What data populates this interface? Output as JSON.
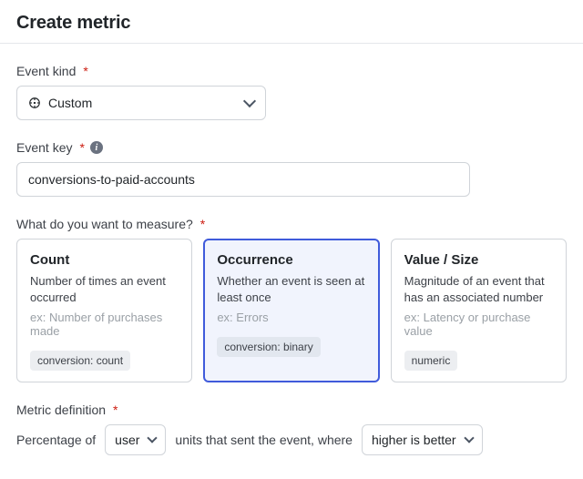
{
  "title": "Create metric",
  "labels": {
    "event_kind": "Event kind",
    "event_key": "Event key",
    "measure_q": "What do you want to measure?",
    "metric_def": "Metric definition"
  },
  "event_kind": {
    "value": "Custom"
  },
  "event_key": {
    "value": "conversions-to-paid-accounts"
  },
  "measure": {
    "selected_index": 1,
    "options": [
      {
        "title": "Count",
        "desc": "Number of times an event occurred",
        "example": "ex: Number of purchases made",
        "tag": "conversion: count"
      },
      {
        "title": "Occurrence",
        "desc": "Whether an event is seen at least once",
        "example": "ex: Errors",
        "tag": "conversion: binary"
      },
      {
        "title": "Value / Size",
        "desc": "Magnitude of an event that has an associated number",
        "example": "ex: Latency or purchase value",
        "tag": "numeric"
      }
    ]
  },
  "definition": {
    "prefix": "Percentage of",
    "unit_value": "user",
    "middle": "units that sent the event, where",
    "direction_value": "higher is better"
  }
}
